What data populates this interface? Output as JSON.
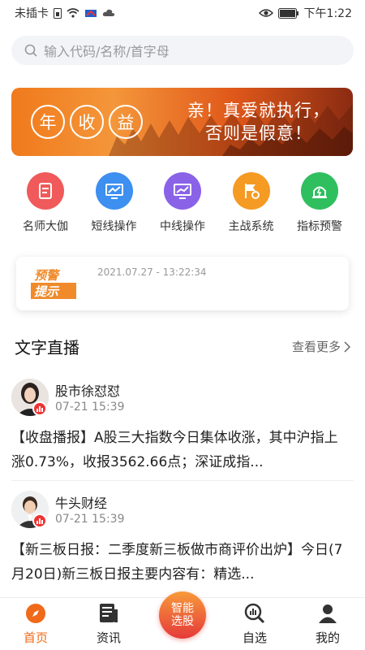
{
  "status": {
    "carrier": "未插卡",
    "time": "下午1:22",
    "icons": [
      "sim-icon",
      "wifi-icon",
      "app-icon",
      "cloud-icon",
      "eye-icon",
      "battery-icon"
    ]
  },
  "search": {
    "placeholder": "输入代码/名称/首字母"
  },
  "banner": {
    "circle_chars": [
      "年",
      "收",
      "益"
    ],
    "slogan_line1": "亲！真爱就执行，",
    "slogan_line2": "否则是假意！"
  },
  "quick": [
    {
      "label": "名师大伽",
      "color": "#f05a5a",
      "icon": "teacher-icon"
    },
    {
      "label": "短线操作",
      "color": "#3d8ff0",
      "icon": "chart-monitor-icon"
    },
    {
      "label": "中线操作",
      "color": "#8a62e8",
      "icon": "chart-monitor-icon"
    },
    {
      "label": "主战系统",
      "color": "#f59a22",
      "icon": "flag-gear-icon"
    },
    {
      "label": "指标预警",
      "color": "#2fbf5f",
      "icon": "alarm-icon"
    }
  ],
  "alert": {
    "badge_line1": "预警",
    "badge_line2": "提示",
    "date": "2021.07.27 - 13:22:34"
  },
  "section": {
    "title": "文字直播",
    "more": "查看更多"
  },
  "posts": [
    {
      "name": "股市徐怼怼",
      "time": "07-21 15:39",
      "text": "【收盘播报】A股三大指数今日集体收涨，其中沪指上涨0.73%，收报3562.66点；深证成指..."
    },
    {
      "name": "牛头财经",
      "time": "07-21 15:39",
      "text": "【新三板日报：二季度新三板做市商评价出炉】今日(7月20日)新三板日报主要内容有：精选..."
    }
  ],
  "tabs": {
    "home": "首页",
    "news": "资讯",
    "center": "智能选股",
    "watch": "自选",
    "mine": "我的"
  },
  "colors": {
    "accent": "#f06a1a"
  }
}
